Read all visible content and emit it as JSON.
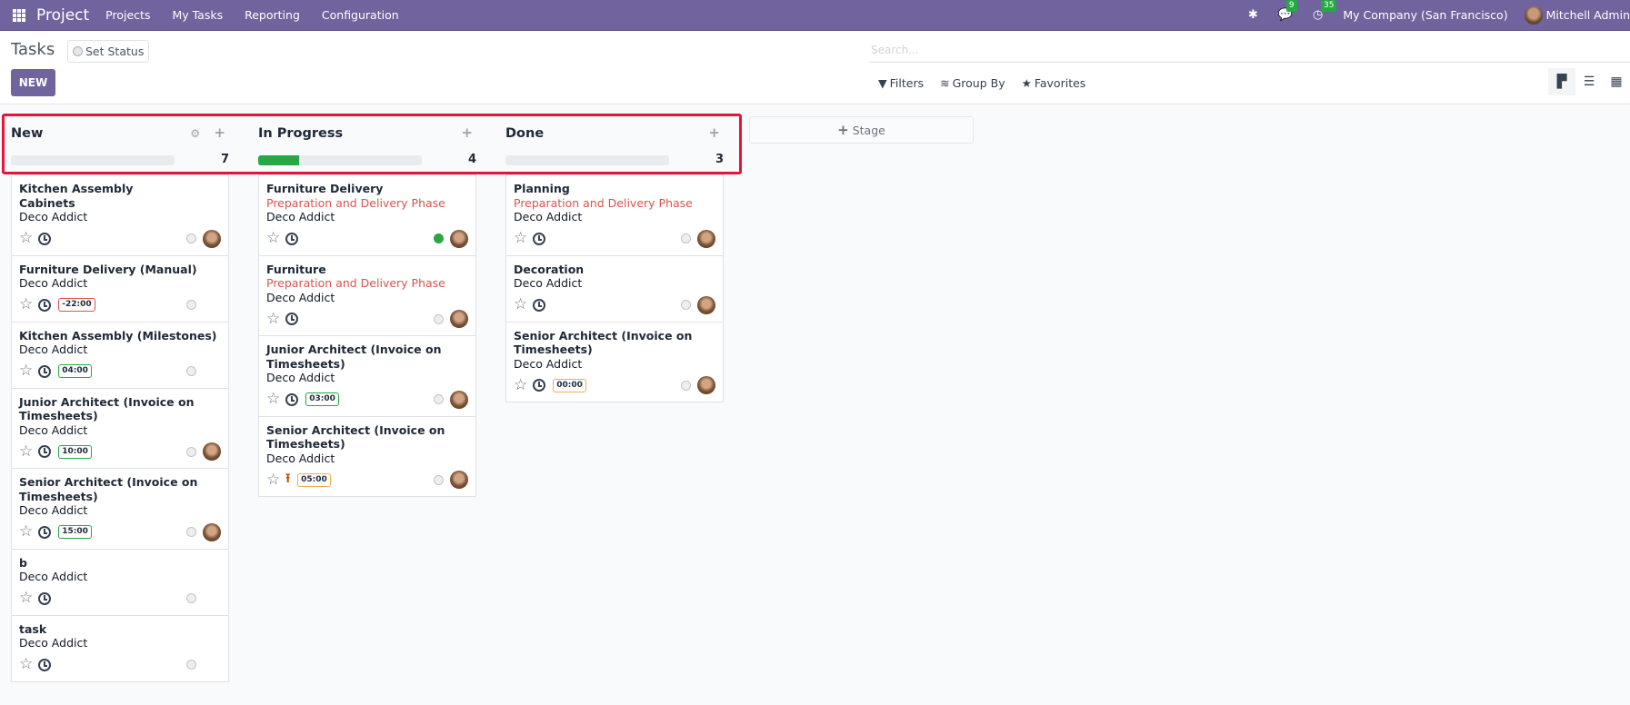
{
  "navbar": {
    "app_name": "Project",
    "menu": [
      "Projects",
      "My Tasks",
      "Reporting",
      "Configuration"
    ],
    "icons": [
      "bug-icon",
      "chat-icon",
      "clock-icon"
    ],
    "messages_badge": "9",
    "activities_badge": "35",
    "company": "My Company (San Francisco)",
    "user": "Mitchell Admin"
  },
  "control_panel": {
    "title": "Tasks",
    "set_status_label": "Set Status",
    "new_label": "NEW",
    "search_placeholder": "Search...",
    "filters_label": "Filters",
    "group_by_label": "Group By",
    "favorites_label": "Favorites",
    "views": [
      "kanban",
      "list",
      "calendar"
    ],
    "active_view": "kanban"
  },
  "colors": {
    "brand": "#71639e",
    "highlight": "#e8133b",
    "success": "#28a745",
    "milestone": "#d9534f"
  },
  "columns": [
    {
      "title": "New",
      "count": "7",
      "progress_done_fraction": 0,
      "cards": [
        {
          "title": "Kitchen Assembly",
          "subtitle": "Cabinets",
          "milestone": "",
          "partner": "Deco Addict",
          "activity": "clock",
          "hours": "",
          "hours_color": "",
          "state": "normal",
          "avatar": true
        },
        {
          "title": "Furniture Delivery (Manual)",
          "subtitle": "",
          "milestone": "",
          "partner": "Deco Addict",
          "activity": "clock",
          "hours": "-22:00",
          "hours_color": "red",
          "state": "normal",
          "avatar": false
        },
        {
          "title": "Kitchen Assembly (Milestones)",
          "subtitle": "",
          "milestone": "",
          "partner": "Deco Addict",
          "activity": "clock",
          "hours": "04:00",
          "hours_color": "green",
          "state": "normal",
          "avatar": false
        },
        {
          "title": "Junior Architect (Invoice on Timesheets)",
          "subtitle": "",
          "milestone": "",
          "partner": "Deco Addict",
          "activity": "clock",
          "hours": "10:00",
          "hours_color": "green",
          "state": "normal",
          "avatar": true
        },
        {
          "title": "Senior Architect (Invoice on Timesheets)",
          "subtitle": "",
          "milestone": "",
          "partner": "Deco Addict",
          "activity": "clock",
          "hours": "15:00",
          "hours_color": "green",
          "state": "normal",
          "avatar": true
        },
        {
          "title": "b",
          "subtitle": "",
          "milestone": "",
          "partner": "Deco Addict",
          "activity": "clock",
          "hours": "",
          "hours_color": "",
          "state": "normal",
          "avatar": false
        },
        {
          "title": "task",
          "subtitle": "",
          "milestone": "",
          "partner": "Deco Addict",
          "activity": "clock",
          "hours": "",
          "hours_color": "",
          "state": "normal",
          "avatar": false
        }
      ]
    },
    {
      "title": "In Progress",
      "count": "4",
      "progress_done_fraction": 0.25,
      "cards": [
        {
          "title": "Furniture Delivery",
          "subtitle": "",
          "milestone": "Preparation and Delivery Phase",
          "partner": "Deco Addict",
          "activity": "clock",
          "hours": "",
          "hours_color": "",
          "state": "done",
          "avatar": true
        },
        {
          "title": "Furniture",
          "subtitle": "",
          "milestone": "Preparation and Delivery Phase",
          "partner": "Deco Addict",
          "activity": "clock",
          "hours": "",
          "hours_color": "",
          "state": "normal",
          "avatar": true
        },
        {
          "title": "Junior Architect (Invoice on Timesheets)",
          "subtitle": "",
          "milestone": "",
          "partner": "Deco Addict",
          "activity": "clock",
          "hours": "03:00",
          "hours_color": "green",
          "state": "normal",
          "avatar": true
        },
        {
          "title": "Senior Architect (Invoice on Timesheets)",
          "subtitle": "",
          "milestone": "",
          "partner": "Deco Addict",
          "activity": "upload",
          "hours": "05:00",
          "hours_color": "orange",
          "state": "normal",
          "avatar": true
        }
      ]
    },
    {
      "title": "Done",
      "count": "3",
      "progress_done_fraction": 0,
      "cards": [
        {
          "title": "Planning",
          "subtitle": "",
          "milestone": "Preparation and Delivery Phase",
          "partner": "Deco Addict",
          "activity": "clock",
          "hours": "",
          "hours_color": "",
          "state": "normal",
          "avatar": true
        },
        {
          "title": "Decoration",
          "subtitle": "",
          "milestone": "",
          "partner": "Deco Addict",
          "activity": "clock",
          "hours": "",
          "hours_color": "",
          "state": "normal",
          "avatar": true
        },
        {
          "title": "Senior Architect (Invoice on Timesheets)",
          "subtitle": "",
          "milestone": "",
          "partner": "Deco Addict",
          "activity": "clock",
          "hours": "00:00",
          "hours_color": "orange",
          "state": "normal",
          "avatar": true
        }
      ]
    }
  ],
  "add_stage_label": "Stage"
}
